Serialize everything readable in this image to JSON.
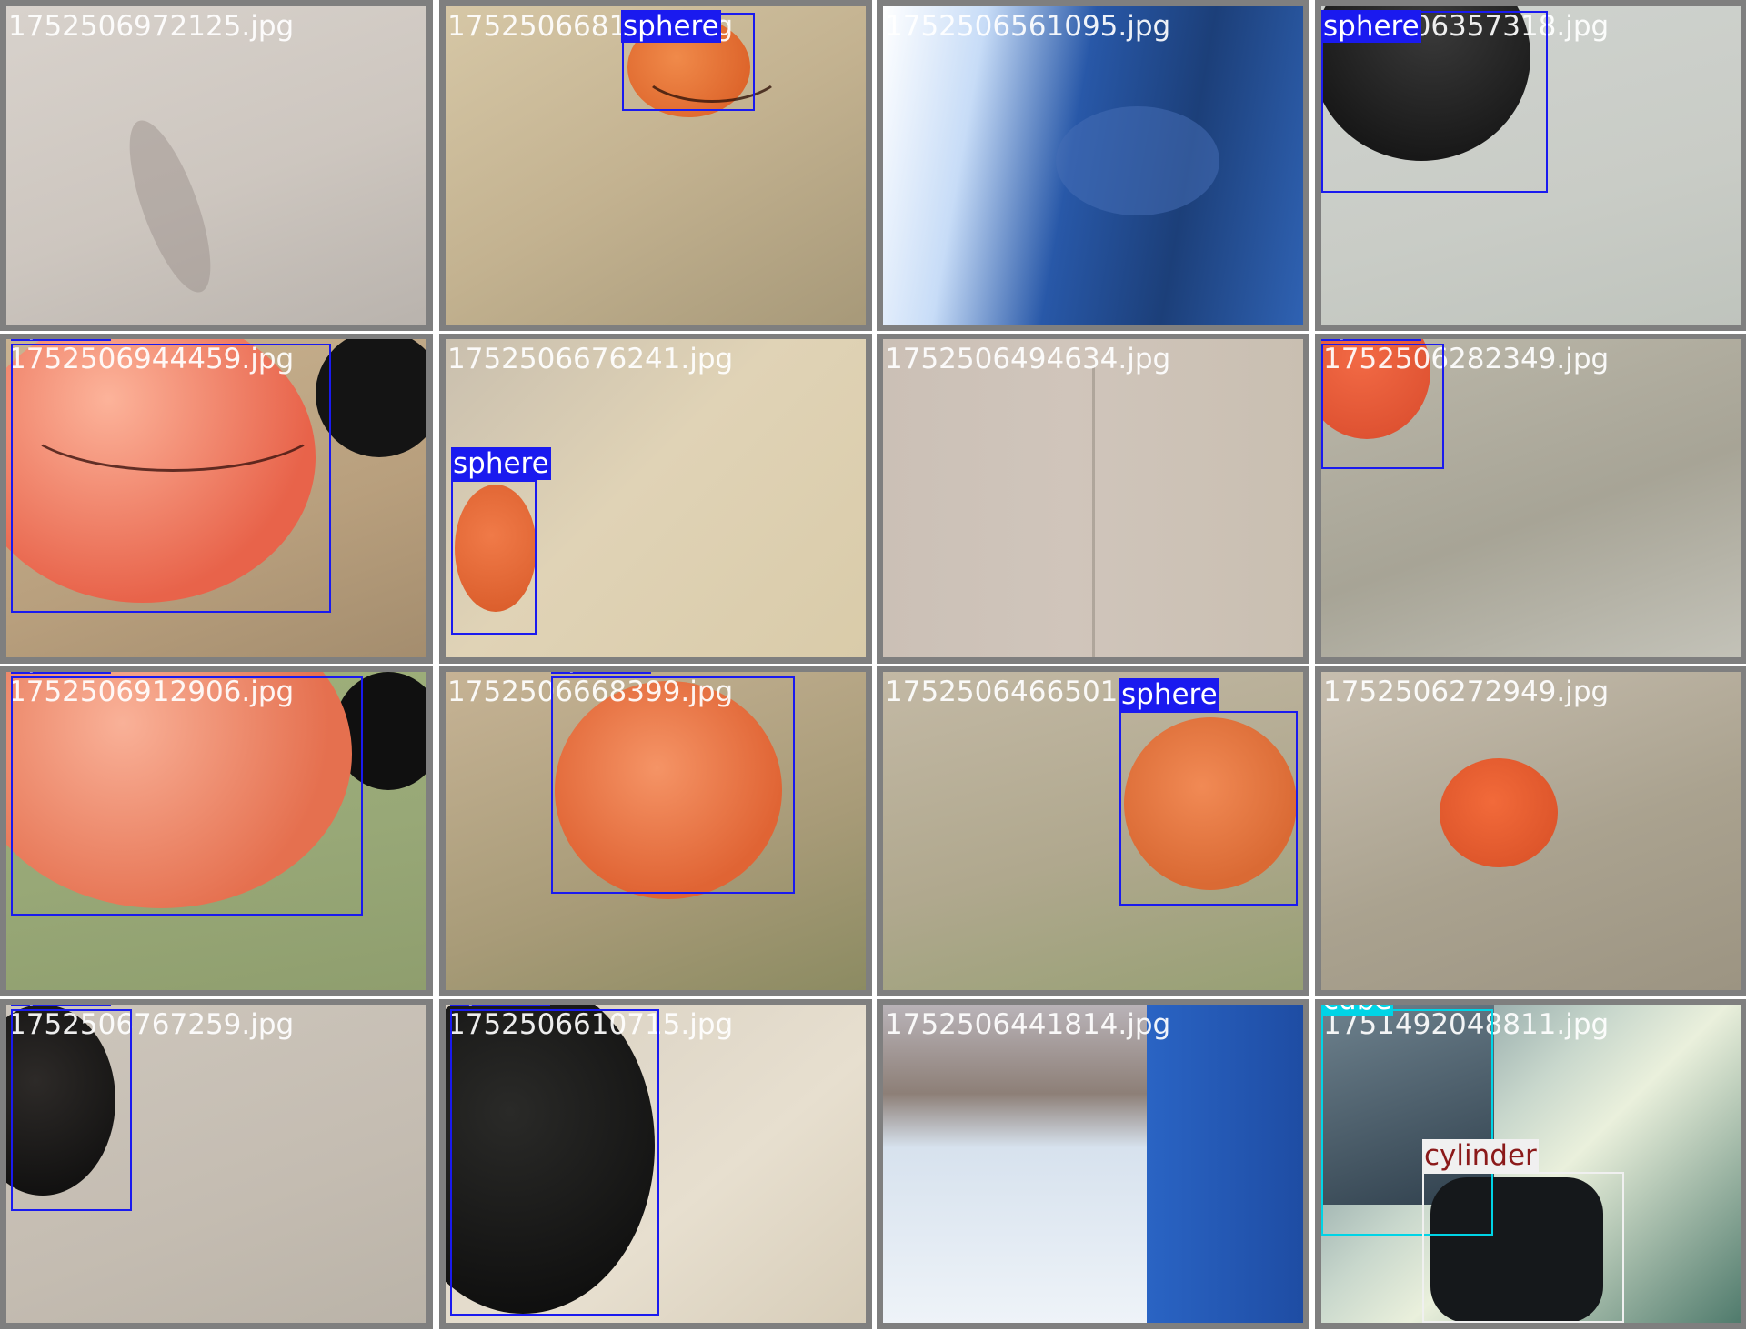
{
  "tiles": [
    {
      "filename": "1752506972125.jpg",
      "boxes": []
    },
    {
      "filename": "1752506681231.jpg",
      "boxes": [
        {
          "label": "sphere",
          "class": "sphere"
        }
      ]
    },
    {
      "filename": "1752506561095.jpg",
      "boxes": []
    },
    {
      "filename": "1752506357318.jpg",
      "boxes": [
        {
          "label": "sphere",
          "class": "sphere"
        }
      ]
    },
    {
      "filename": "1752506944459.jpg",
      "boxes": [
        {
          "label": "sphere",
          "class": "sphere"
        }
      ]
    },
    {
      "filename": "1752506676241.jpg",
      "boxes": [
        {
          "label": "sphere",
          "class": "sphere"
        }
      ]
    },
    {
      "filename": "1752506494634.jpg",
      "boxes": []
    },
    {
      "filename": "1752506282349.jpg",
      "boxes": [
        {
          "label": "sphere",
          "class": "sphere"
        }
      ]
    },
    {
      "filename": "1752506912906.jpg",
      "boxes": [
        {
          "label": "sphere",
          "class": "sphere"
        }
      ]
    },
    {
      "filename": "1752506668399.jpg",
      "boxes": [
        {
          "label": "sphere",
          "class": "sphere"
        }
      ]
    },
    {
      "filename": "1752506466501.jpg",
      "boxes": [
        {
          "label": "sphere",
          "class": "sphere"
        }
      ]
    },
    {
      "filename": "1752506272949.jpg",
      "boxes": []
    },
    {
      "filename": "1752506767259.jpg",
      "boxes": [
        {
          "label": "sphere",
          "class": "sphere"
        }
      ]
    },
    {
      "filename": "1752506610715.jpg",
      "boxes": [
        {
          "label": "sphere",
          "class": "sphere"
        }
      ]
    },
    {
      "filename": "1752506441814.jpg",
      "boxes": []
    },
    {
      "filename": "1751492048811.jpg",
      "boxes": [
        {
          "label": "cube",
          "class": "cube"
        },
        {
          "label": "cylinder",
          "class": "cylinder"
        }
      ]
    }
  ],
  "colors": {
    "sphere": "#1a1aef",
    "cube": "#00d4e6",
    "cylinder": "#f0f0f0",
    "cylinder_text": "#8b1a1a",
    "tile_border": "#7f7f7f"
  }
}
